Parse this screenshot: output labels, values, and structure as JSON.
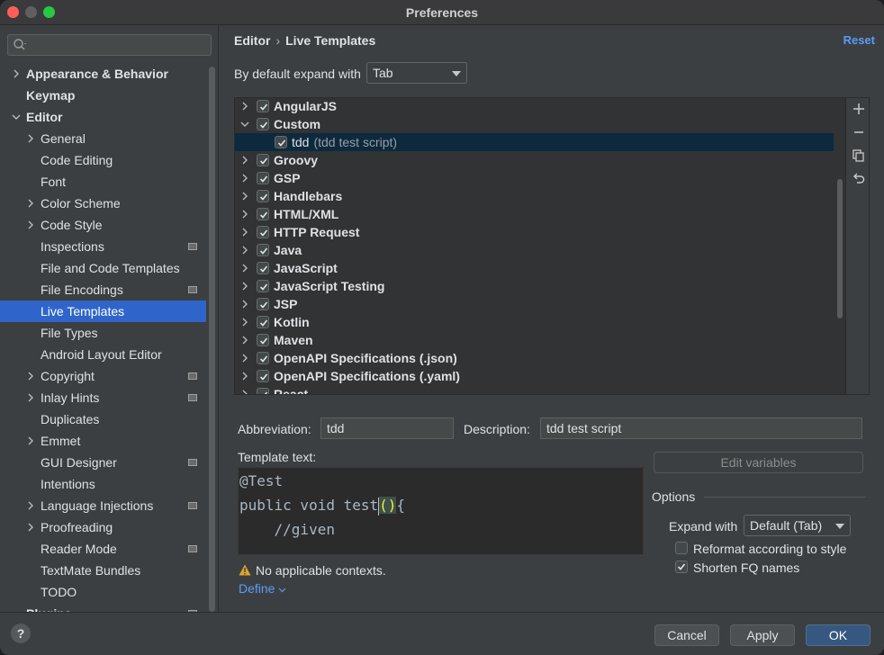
{
  "window": {
    "title": "Preferences"
  },
  "sidebar": {
    "search": {
      "placeholder": ""
    },
    "items": [
      {
        "label": "Appearance & Behavior",
        "bold": true,
        "expandable": true,
        "expanded": false,
        "level": 0
      },
      {
        "label": "Keymap",
        "bold": true,
        "expandable": false,
        "level": 0
      },
      {
        "label": "Editor",
        "bold": true,
        "expandable": true,
        "expanded": true,
        "level": 0
      },
      {
        "label": "General",
        "expandable": true,
        "level": 1
      },
      {
        "label": "Code Editing",
        "level": 1
      },
      {
        "label": "Font",
        "level": 1
      },
      {
        "label": "Color Scheme",
        "expandable": true,
        "level": 1
      },
      {
        "label": "Code Style",
        "expandable": true,
        "level": 1
      },
      {
        "label": "Inspections",
        "level": 1,
        "badge": true
      },
      {
        "label": "File and Code Templates",
        "level": 1
      },
      {
        "label": "File Encodings",
        "level": 1,
        "badge": true
      },
      {
        "label": "Live Templates",
        "level": 1,
        "selected": true
      },
      {
        "label": "File Types",
        "level": 1
      },
      {
        "label": "Android Layout Editor",
        "level": 1
      },
      {
        "label": "Copyright",
        "expandable": true,
        "level": 1,
        "badge": true
      },
      {
        "label": "Inlay Hints",
        "expandable": true,
        "level": 1,
        "badge": true
      },
      {
        "label": "Duplicates",
        "level": 1
      },
      {
        "label": "Emmet",
        "expandable": true,
        "level": 1
      },
      {
        "label": "GUI Designer",
        "level": 1,
        "badge": true
      },
      {
        "label": "Intentions",
        "level": 1
      },
      {
        "label": "Language Injections",
        "expandable": true,
        "level": 1,
        "badge": true
      },
      {
        "label": "Proofreading",
        "expandable": true,
        "level": 1
      },
      {
        "label": "Reader Mode",
        "level": 1,
        "badge": true
      },
      {
        "label": "TextMate Bundles",
        "level": 1
      },
      {
        "label": "TODO",
        "level": 1
      },
      {
        "label": "Plugins",
        "bold": true,
        "level": 0,
        "badge": true
      }
    ]
  },
  "header": {
    "breadcrumb": [
      "Editor",
      "Live Templates"
    ],
    "reset_label": "Reset"
  },
  "expand_default": {
    "label": "By default expand with",
    "value": "Tab"
  },
  "templates": [
    {
      "label": "AngularJS",
      "checked": true,
      "expanded": false
    },
    {
      "label": "Custom",
      "checked": true,
      "expanded": true
    },
    {
      "label": "tdd",
      "desc": "(tdd test script)",
      "checked": true,
      "child": true,
      "selected": true
    },
    {
      "label": "Groovy",
      "checked": true
    },
    {
      "label": "GSP",
      "checked": true
    },
    {
      "label": "Handlebars",
      "checked": true
    },
    {
      "label": "HTML/XML",
      "checked": true
    },
    {
      "label": "HTTP Request",
      "checked": true
    },
    {
      "label": "Java",
      "checked": true
    },
    {
      "label": "JavaScript",
      "checked": true
    },
    {
      "label": "JavaScript Testing",
      "checked": true
    },
    {
      "label": "JSP",
      "checked": true
    },
    {
      "label": "Kotlin",
      "checked": true
    },
    {
      "label": "Maven",
      "checked": true
    },
    {
      "label": "OpenAPI Specifications (.json)",
      "checked": true
    },
    {
      "label": "OpenAPI Specifications (.yaml)",
      "checked": true
    },
    {
      "label": "React",
      "checked": true
    }
  ],
  "tools": {
    "add": "+",
    "remove": "−",
    "copy": "copy-icon",
    "revert": "revert-icon"
  },
  "abbreviation": {
    "label": "Abbreviation:",
    "value": "tdd"
  },
  "description": {
    "label": "Description:",
    "value": "tdd test script"
  },
  "template_text": {
    "label": "Template text:",
    "lines": [
      "@Test",
      "public void test",
      "    //given"
    ],
    "paren": "()",
    "brace": "{"
  },
  "edit_variables_label": "Edit variables",
  "options": {
    "title": "Options",
    "expand_with": {
      "label": "Expand with",
      "value": "Default (Tab)"
    },
    "reformat": {
      "label": "Reformat according to style",
      "checked": false
    },
    "shorten_fq": {
      "label": "Shorten FQ names",
      "checked": true
    }
  },
  "contexts": {
    "warning": "No applicable contexts.",
    "define_label": "Define"
  },
  "footer": {
    "help": "?",
    "cancel": "Cancel",
    "apply": "Apply",
    "ok": "OK"
  },
  "colors": {
    "accent": "#589df6",
    "selection": "#2f65ca",
    "list_selection": "#0d293e",
    "primary_button": "#365880"
  }
}
